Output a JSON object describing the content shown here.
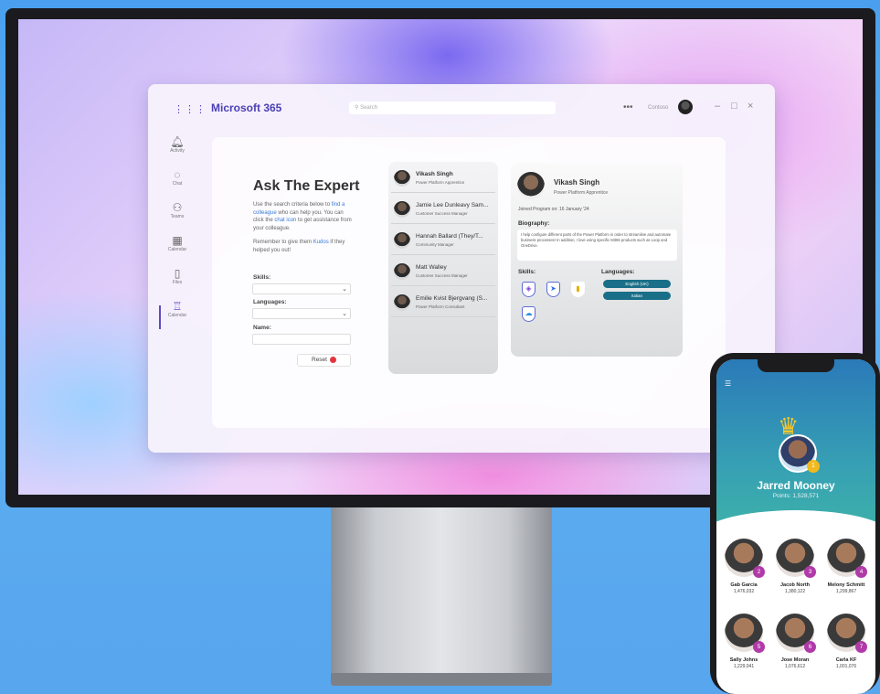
{
  "teams": {
    "brand": "Microsoft 365",
    "search_placeholder": "Search",
    "more": "•••",
    "account_name": "Contoso",
    "rail": [
      {
        "label": "Activity",
        "icon": "bell-icon"
      },
      {
        "label": "Chat",
        "icon": "chat-icon"
      },
      {
        "label": "Teams",
        "icon": "teams-icon"
      },
      {
        "label": "Calendar",
        "icon": "calendar-icon"
      },
      {
        "label": "Files",
        "icon": "file-icon"
      },
      {
        "label": "Calendar",
        "icon": "trophy-icon"
      }
    ]
  },
  "app": {
    "title": "Ask The Expert",
    "desc_part1": "Use the search criteria below to",
    "desc_link1": "find a colleague",
    "desc_part2": "who can help you. You can click the",
    "desc_link2": "chat icon",
    "desc_part3": "to get assistance from your colleague.",
    "kudos_part1": "Remember to give them",
    "kudos_link": "Kudos",
    "kudos_part2": "if they helped you out!",
    "skills_label": "Skills:",
    "languages_label": "Languages:",
    "name_label": "Name:",
    "reset_label": "Reset"
  },
  "people": [
    {
      "name": "Vikash Singh",
      "role": "Power Platform Apprentice"
    },
    {
      "name": "Jamie Lee Dunleavy Sam...",
      "role": "Customer Success Manager"
    },
    {
      "name": "Hannah Ballard (They/T...",
      "role": "Community Manager"
    },
    {
      "name": "Matt Walley",
      "role": "Customer Success Manager"
    },
    {
      "name": "Emilie Kvist Bjergvang (S...",
      "role": "Power Platform Consultant"
    }
  ],
  "profile": {
    "name": "Vikash Singh",
    "role": "Power Platform Apprentice",
    "joined": "Joined Program on: 16 January '24",
    "bio_heading": "Biography:",
    "bio": "I help configure different parts of the Power Platform in order to streamline and automate business processes! In addition, I love using specific M365 products such as Loop and OneDrive.",
    "skills_heading": "Skills:",
    "languages_heading": "Languages:",
    "languages": [
      "English (UK)",
      "Italian"
    ]
  },
  "phone": {
    "winner_name": "Jarred Mooney",
    "winner_points": "Points: 1,528,571",
    "winner_rank": "1",
    "leaders": [
      {
        "name": "Gab Garcia",
        "points": "1,476,032",
        "rank": "2"
      },
      {
        "name": "Jacob North",
        "points": "1,380,122",
        "rank": "3"
      },
      {
        "name": "Melony Schmitt",
        "points": "1,299,867",
        "rank": "4"
      },
      {
        "name": "Sally Johns",
        "points": "1,229,041",
        "rank": "5"
      },
      {
        "name": "Jose Moran",
        "points": "1,076,612",
        "rank": "6"
      },
      {
        "name": "Carla KF",
        "points": "1,001,076",
        "rank": "7"
      }
    ]
  },
  "colors": {
    "brand": "#4b3fb5",
    "reset": "#e3353e",
    "language_pill": "#1a6f88",
    "rank_badge": "#b03aa8",
    "gold": "#f0b91f"
  }
}
